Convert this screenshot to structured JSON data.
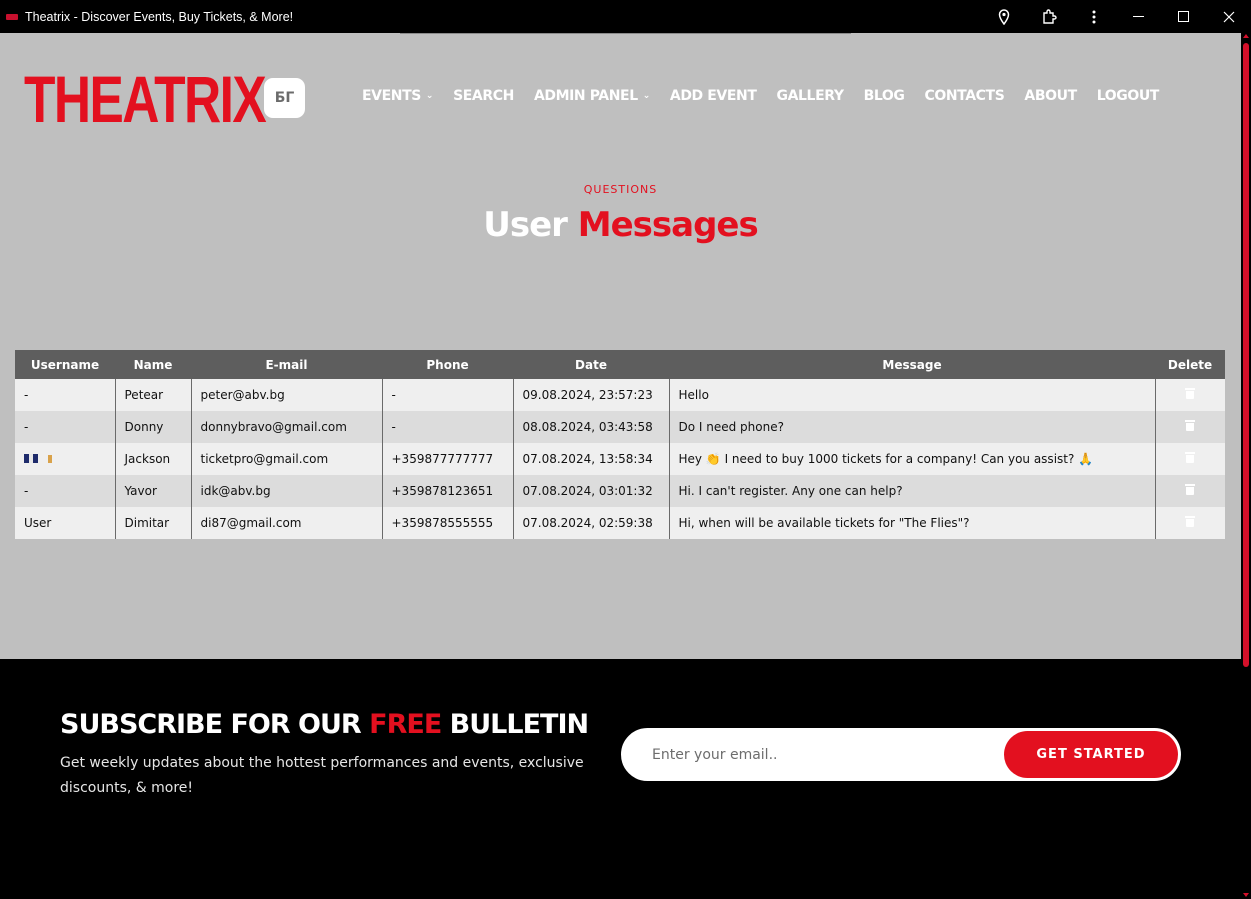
{
  "window": {
    "title": "Theatrix - Discover Events, Buy Tickets, & More!"
  },
  "header": {
    "logo": "THEATRIX",
    "lang_button": "БГ",
    "nav": [
      {
        "label": "EVENTS",
        "has_dropdown": true
      },
      {
        "label": "SEARCH",
        "has_dropdown": false
      },
      {
        "label": "ADMIN PANEL",
        "has_dropdown": true
      },
      {
        "label": "ADD EVENT",
        "has_dropdown": false
      },
      {
        "label": "GALLERY",
        "has_dropdown": false
      },
      {
        "label": "BLOG",
        "has_dropdown": false
      },
      {
        "label": "CONTACTS",
        "has_dropdown": false
      },
      {
        "label": "ABOUT",
        "has_dropdown": false
      },
      {
        "label": "LOGOUT",
        "has_dropdown": false
      }
    ]
  },
  "section": {
    "eyebrow": "QUESTIONS",
    "title_white": "User",
    "title_red": "Messages"
  },
  "table": {
    "columns": [
      "Username",
      "Name",
      "E-mail",
      "Phone",
      "Date",
      "Message",
      "Delete"
    ],
    "rows": [
      {
        "username": "-",
        "name": "Petear",
        "email": "peter@abv.bg",
        "phone": "-",
        "date": "09.08.2024, 23:57:23",
        "message": "Hello"
      },
      {
        "username": "-",
        "name": "Donny",
        "email": "donnybravo@gmail.com",
        "phone": "-",
        "date": "08.08.2024, 03:43:58",
        "message": "Do I need phone?"
      },
      {
        "username": "",
        "name": "Jackson",
        "email": "ticketpro@gmail.com",
        "phone": "+359877777777",
        "date": "07.08.2024, 13:58:34",
        "message": "Hey 👏 I need to buy 1000 tickets for a company! Can you assist? 🙏"
      },
      {
        "username": "-",
        "name": "Yavor",
        "email": "idk@abv.bg",
        "phone": "+359878123651",
        "date": "07.08.2024, 03:01:32",
        "message": "Hi. I can't register. Any one can help?"
      },
      {
        "username": "User",
        "name": "Dimitar",
        "email": "di87@gmail.com",
        "phone": "+359878555555",
        "date": "07.08.2024, 02:59:38",
        "message": "Hi, when will be available tickets for \"The Flies\"?"
      }
    ]
  },
  "footer": {
    "title_a": "SUBSCRIBE FOR OUR",
    "title_red": "FREE",
    "title_b": "BULLETIN",
    "text": "Get weekly updates about the hottest performances and events, exclusive discounts, & more!",
    "email_placeholder": "Enter your email..",
    "cta_label": "GET STARTED"
  },
  "colors": {
    "brand_red": "#e3101f",
    "page_bg": "#bfbfbf",
    "table_header": "#5e5e5e"
  }
}
